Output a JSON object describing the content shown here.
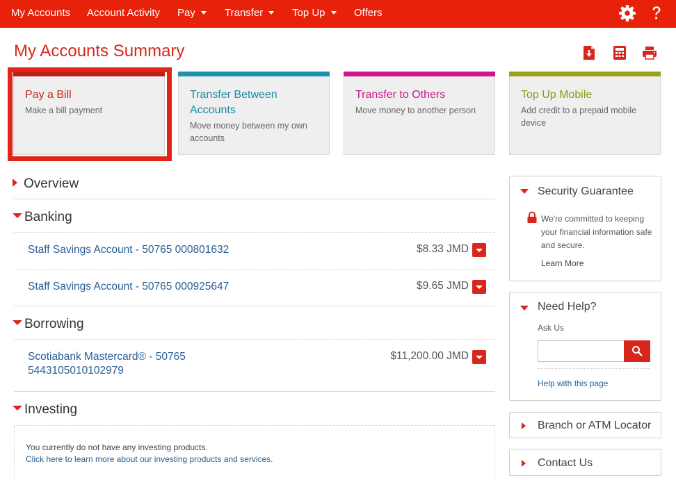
{
  "nav": {
    "items": [
      {
        "label": "My Accounts",
        "dropdown": false
      },
      {
        "label": "Account Activity",
        "dropdown": false
      },
      {
        "label": "Pay",
        "dropdown": true
      },
      {
        "label": "Transfer",
        "dropdown": true
      },
      {
        "label": "Top Up",
        "dropdown": true
      },
      {
        "label": "Offers",
        "dropdown": false
      }
    ],
    "icons": [
      "gear-icon",
      "help-icon"
    ]
  },
  "page": {
    "title": "My Accounts Summary",
    "tools": [
      "download-icon",
      "calculator-icon",
      "print-icon"
    ]
  },
  "cards": [
    {
      "title": "Pay a Bill",
      "desc": "Make a bill payment",
      "color": "#b7211a",
      "title_color": "#c0281d",
      "selected": true
    },
    {
      "title": "Transfer Between Accounts",
      "desc": "Move money between my own accounts",
      "color": "#1a93ab",
      "title_color": "#1a8aa3"
    },
    {
      "title": "Transfer to Others",
      "desc": "Move money to another person",
      "color": "#d0148c",
      "title_color": "#c8168a"
    },
    {
      "title": "Top Up Mobile",
      "desc": "Add credit to a prepaid mobile device",
      "color": "#98a11a",
      "title_color": "#8c9a10"
    }
  ],
  "sections": {
    "overview": {
      "title": "Overview"
    },
    "banking": {
      "title": "Banking",
      "accounts": [
        {
          "name": "Staff Savings Account - 50765 000801632",
          "balance": "$8.33 JMD"
        },
        {
          "name": "Staff Savings Account - 50765 000925647",
          "balance": "$9.65 JMD"
        }
      ]
    },
    "borrowing": {
      "title": "Borrowing",
      "accounts": [
        {
          "name": "Scotiabank Mastercard® - 50765 5443105010102979",
          "balance": "$11,200.00 JMD"
        }
      ]
    },
    "investing": {
      "title": "Investing",
      "message": "You currently do not have any investing products.",
      "link": "Click here to learn more about our investing products and services."
    }
  },
  "sidebar": {
    "security": {
      "title": "Security Guarantee",
      "text": "We're committed to keeping your financial information safe and secure.",
      "link": "Learn More"
    },
    "help": {
      "title": "Need Help?",
      "ask_label": "Ask Us",
      "search_value": "",
      "link": "Help with this page"
    },
    "locator": {
      "title": "Branch or ATM Locator"
    },
    "contact": {
      "title": "Contact Us"
    }
  },
  "colors": {
    "brand": "#e8210a",
    "link": "#2a5d96",
    "accent": "#d8261a"
  }
}
